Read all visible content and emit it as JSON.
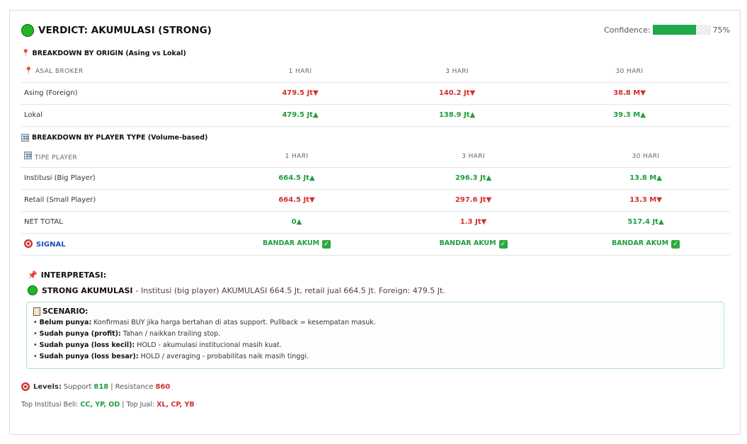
{
  "verdict": {
    "title": "VERDICT: AKUMULASI (STRONG)"
  },
  "confidence": {
    "label": "Confidence:",
    "value": 0.75,
    "text": "75%"
  },
  "origin": {
    "title": "BREAKDOWN BY ORIGIN (Asing vs Lokal)",
    "headers": [
      "ASAL BROKER",
      "1 HARI",
      "3 HARI",
      "30 HARI"
    ],
    "rows": [
      {
        "label": "Asing (Foreign)",
        "cells": [
          {
            "text": "479.5 Jt▼",
            "dir": "down"
          },
          {
            "text": "140.2 Jt▼",
            "dir": "down"
          },
          {
            "text": "38.8 M▼",
            "dir": "down"
          }
        ]
      },
      {
        "label": "Lokal",
        "cells": [
          {
            "text": "479.5 Jt▲",
            "dir": "up"
          },
          {
            "text": "138.9 Jt▲",
            "dir": "up"
          },
          {
            "text": "39.3 M▲",
            "dir": "up"
          }
        ]
      }
    ]
  },
  "player": {
    "title": "BREAKDOWN BY PLAYER TYPE (Volume-based)",
    "headers": [
      "TIPE PLAYER",
      "1 HARI",
      "3 HARI",
      "30 HARI"
    ],
    "rows": [
      {
        "label": "Institusi (Big Player)",
        "cells": [
          {
            "text": "664.5 Jt▲",
            "dir": "up"
          },
          {
            "text": "296.3 Jt▲",
            "dir": "up"
          },
          {
            "text": "13.8 M▲",
            "dir": "up"
          }
        ]
      },
      {
        "label": "Retail (Small Player)",
        "cells": [
          {
            "text": "664.5 Jt▼",
            "dir": "down"
          },
          {
            "text": "297.6 Jt▼",
            "dir": "down"
          },
          {
            "text": "13.3 M▼",
            "dir": "down"
          }
        ]
      },
      {
        "label": "NET TOTAL",
        "cells": [
          {
            "text": "0▲",
            "dir": "up"
          },
          {
            "text": "1.3 Jt▼",
            "dir": "down"
          },
          {
            "text": "517.4 Jt▲",
            "dir": "up"
          }
        ]
      }
    ],
    "signal": {
      "label": "SIGNAL",
      "values": [
        "BANDAR AKUM",
        "BANDAR AKUM",
        "BANDAR AKUM"
      ]
    }
  },
  "interpretation": {
    "title": "INTERPRETASI:",
    "headline": "STRONG AKUMULASI",
    "text": "- Institusi (big player) AKUMULASI 664.5 Jt, retail jual 664.5 Jt. Foreign: 479.5 Jt."
  },
  "scenario": {
    "title": "SCENARIO:",
    "items": [
      {
        "label": "Belum punya:",
        "text": " Konfirmasi BUY jika harga bertahan di atas support. Pullback = kesempatan masuk."
      },
      {
        "label": "Sudah punya (profit):",
        "text": " Tahan / naikkan trailing stop."
      },
      {
        "label": "Sudah punya (loss kecil):",
        "text": " HOLD - akumulasi institucional masih kuat."
      },
      {
        "label": "Sudah punya (loss besar):",
        "text": " HOLD / averaging - probabilitas naik masih tinggi."
      }
    ]
  },
  "levels": {
    "label": "Levels:",
    "support_label": "Support",
    "support": "818",
    "sep": "|",
    "resistance_label": "Resistance",
    "resistance": "860"
  },
  "top": {
    "beli_label": "Top Institusi Beli:",
    "beli": "CC, YP, OD",
    "sep": "|",
    "jual_label": "Top Jual:",
    "jual": "XL, CP, YB"
  },
  "colors": {
    "up": "#1f9d3f",
    "down": "#d32f2f",
    "accent": "#1ea84a",
    "signal": "#1f4fbf"
  },
  "icons": {
    "verdict": "green-circle-icon",
    "pin": "pushpin-icon",
    "building": "office-building-icon",
    "target": "target-icon",
    "check": "check-mark-icon",
    "clipboard": "clipboard-icon"
  }
}
